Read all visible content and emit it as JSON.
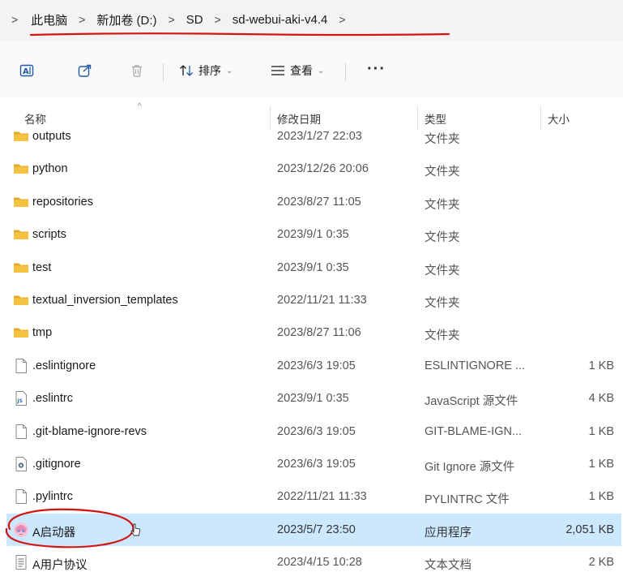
{
  "breadcrumb": {
    "items": [
      "此电脑",
      "新加卷 (D:)",
      "SD",
      "sd-webui-aki-v4.4"
    ],
    "separator": ">"
  },
  "toolbar": {
    "sort_label": "排序",
    "view_label": "查看",
    "more_label": "···"
  },
  "columns": {
    "name": "名称",
    "modified": "修改日期",
    "type": "类型",
    "size": "大小"
  },
  "files": [
    {
      "name": "outputs",
      "modified": "2023/1/27 22:03",
      "type": "文件夹",
      "size": "",
      "icon": "folder-icon"
    },
    {
      "name": "python",
      "modified": "2023/12/26 20:06",
      "type": "文件夹",
      "size": "",
      "icon": "folder-icon"
    },
    {
      "name": "repositories",
      "modified": "2023/8/27 11:05",
      "type": "文件夹",
      "size": "",
      "icon": "folder-icon"
    },
    {
      "name": "scripts",
      "modified": "2023/9/1 0:35",
      "type": "文件夹",
      "size": "",
      "icon": "folder-icon"
    },
    {
      "name": "test",
      "modified": "2023/9/1 0:35",
      "type": "文件夹",
      "size": "",
      "icon": "folder-icon"
    },
    {
      "name": "textual_inversion_templates",
      "modified": "2022/11/21 11:33",
      "type": "文件夹",
      "size": "",
      "icon": "folder-icon"
    },
    {
      "name": "tmp",
      "modified": "2023/8/27 11:06",
      "type": "文件夹",
      "size": "",
      "icon": "folder-icon"
    },
    {
      "name": ".eslintignore",
      "modified": "2023/6/3 19:05",
      "type": "ESLINTIGNORE ...",
      "size": "1 KB",
      "icon": "file-icon"
    },
    {
      "name": ".eslintrc",
      "modified": "2023/9/1 0:35",
      "type": "JavaScript 源文件",
      "size": "4 KB",
      "icon": "js-file-icon"
    },
    {
      "name": ".git-blame-ignore-revs",
      "modified": "2023/6/3 19:05",
      "type": "GIT-BLAME-IGN...",
      "size": "1 KB",
      "icon": "file-icon"
    },
    {
      "name": ".gitignore",
      "modified": "2023/6/3 19:05",
      "type": "Git Ignore 源文件",
      "size": "1 KB",
      "icon": "settings-file-icon"
    },
    {
      "name": ".pylintrc",
      "modified": "2022/11/21 11:33",
      "type": "PYLINTRC 文件",
      "size": "1 KB",
      "icon": "file-icon"
    },
    {
      "name": "A启动器",
      "modified": "2023/5/7 23:50",
      "type": "应用程序",
      "size": "2,051 KB",
      "icon": "app-icon",
      "selected": true
    },
    {
      "name": "A用户协议",
      "modified": "2023/4/15 10:28",
      "type": "文本文档",
      "size": "2 KB",
      "icon": "text-file-icon"
    }
  ],
  "colors": {
    "selection": "#cce8ff",
    "folder": "#f5c242",
    "annotation_red": "#d21414"
  }
}
